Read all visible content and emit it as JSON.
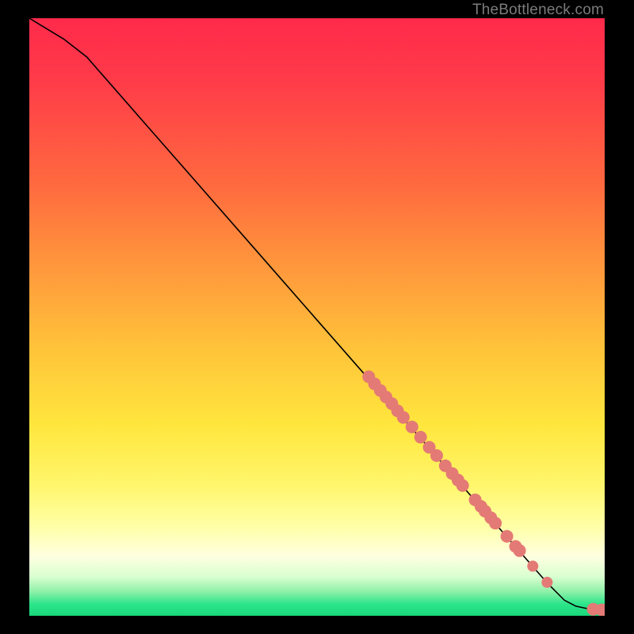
{
  "watermark": "TheBottleneck.com",
  "colors": {
    "marker": "#e47a75",
    "curve": "#000000",
    "gradient_top": "#ff2a4b",
    "gradient_bottom": "#18d87a"
  },
  "chart_data": {
    "type": "line",
    "title": "",
    "xlabel": "",
    "ylabel": "",
    "xlim": [
      0,
      100
    ],
    "ylim": [
      0,
      100
    ],
    "grid": false,
    "curve": [
      {
        "x": 0,
        "y": 100
      },
      {
        "x": 6,
        "y": 96.5
      },
      {
        "x": 10,
        "y": 93.5
      },
      {
        "x": 20,
        "y": 82.5
      },
      {
        "x": 30,
        "y": 71.5
      },
      {
        "x": 40,
        "y": 60.5
      },
      {
        "x": 50,
        "y": 49.5
      },
      {
        "x": 60,
        "y": 38.5
      },
      {
        "x": 70,
        "y": 27.5
      },
      {
        "x": 80,
        "y": 16.5
      },
      {
        "x": 90,
        "y": 5.5
      },
      {
        "x": 93,
        "y": 2.6
      },
      {
        "x": 95,
        "y": 1.6
      },
      {
        "x": 97,
        "y": 1.2
      },
      {
        "x": 100,
        "y": 1.0
      }
    ],
    "markers": [
      {
        "x": 59.0,
        "y": 40.0,
        "r": 8
      },
      {
        "x": 60.0,
        "y": 38.8,
        "r": 8
      },
      {
        "x": 61.0,
        "y": 37.7,
        "r": 8
      },
      {
        "x": 62.0,
        "y": 36.6,
        "r": 8
      },
      {
        "x": 63.0,
        "y": 35.5,
        "r": 8
      },
      {
        "x": 64.0,
        "y": 34.3,
        "r": 8
      },
      {
        "x": 65.0,
        "y": 33.2,
        "r": 8
      },
      {
        "x": 66.5,
        "y": 31.6,
        "r": 8
      },
      {
        "x": 68.0,
        "y": 29.9,
        "r": 8
      },
      {
        "x": 69.5,
        "y": 28.2,
        "r": 8
      },
      {
        "x": 70.8,
        "y": 26.8,
        "r": 8
      },
      {
        "x": 72.3,
        "y": 25.1,
        "r": 8
      },
      {
        "x": 73.5,
        "y": 23.8,
        "r": 8
      },
      {
        "x": 74.5,
        "y": 22.7,
        "r": 8
      },
      {
        "x": 75.3,
        "y": 21.8,
        "r": 8
      },
      {
        "x": 77.5,
        "y": 19.4,
        "r": 8
      },
      {
        "x": 78.5,
        "y": 18.3,
        "r": 8
      },
      {
        "x": 79.2,
        "y": 17.5,
        "r": 8
      },
      {
        "x": 80.2,
        "y": 16.4,
        "r": 8
      },
      {
        "x": 81.0,
        "y": 15.5,
        "r": 8
      },
      {
        "x": 83.0,
        "y": 13.3,
        "r": 8
      },
      {
        "x": 84.5,
        "y": 11.6,
        "r": 8
      },
      {
        "x": 85.2,
        "y": 10.9,
        "r": 8
      },
      {
        "x": 87.5,
        "y": 8.3,
        "r": 7
      },
      {
        "x": 90.0,
        "y": 5.6,
        "r": 7
      },
      {
        "x": 98.0,
        "y": 1.1,
        "r": 8
      },
      {
        "x": 99.5,
        "y": 1.0,
        "r": 8
      }
    ]
  }
}
